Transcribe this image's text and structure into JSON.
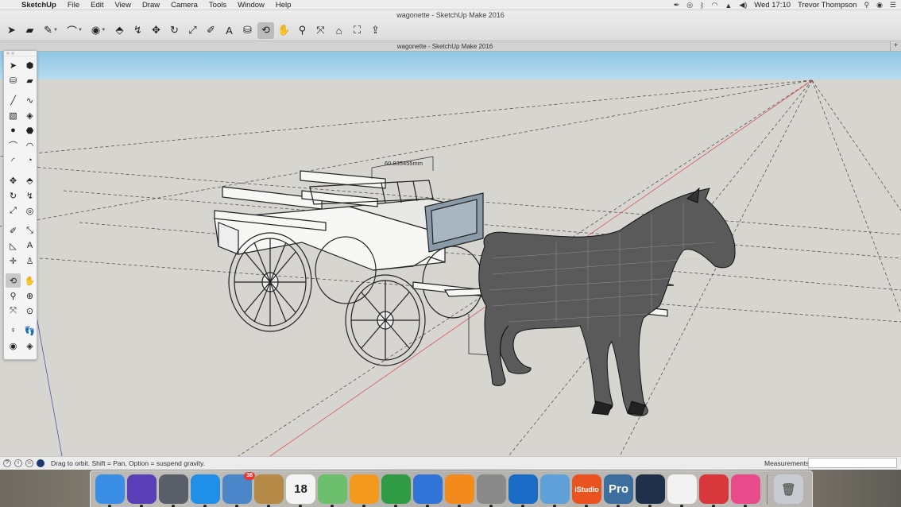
{
  "menubar": {
    "app": "SketchUp",
    "items": [
      "File",
      "Edit",
      "View",
      "Draw",
      "Camera",
      "Tools",
      "Window",
      "Help"
    ],
    "clock": "Wed 17:10",
    "user": "Trevor Thompson"
  },
  "window": {
    "title": "wagonette - SketchUp Make 2016",
    "tab_title": "wagonette - SketchUp Make 2016"
  },
  "toolbar": {
    "tools": [
      {
        "icon": "select-arrow-icon",
        "glyph": "➤"
      },
      {
        "icon": "eraser-icon",
        "glyph": "▰"
      },
      {
        "icon": "pencil-line-icon",
        "glyph": "✎",
        "dropdown": true
      },
      {
        "icon": "arc-icon",
        "glyph": "⌒",
        "dropdown": true
      },
      {
        "icon": "circle-shape-icon",
        "glyph": "◉",
        "dropdown": true
      },
      {
        "icon": "push-pull-icon",
        "glyph": "⬘"
      },
      {
        "icon": "follow-me-icon",
        "glyph": "↯"
      },
      {
        "icon": "move-icon",
        "glyph": "✥"
      },
      {
        "icon": "rotate-icon",
        "glyph": "↻"
      },
      {
        "icon": "scale-icon",
        "glyph": "⤢"
      },
      {
        "icon": "tape-measure-icon",
        "glyph": "✐"
      },
      {
        "icon": "text-icon",
        "glyph": "A"
      },
      {
        "icon": "paint-bucket-icon",
        "glyph": "⛁"
      },
      {
        "icon": "orbit-icon",
        "glyph": "⟲",
        "active": true
      },
      {
        "icon": "pan-icon",
        "glyph": "✋"
      },
      {
        "icon": "zoom-icon",
        "glyph": "⚲"
      },
      {
        "icon": "zoom-extents-icon",
        "glyph": "⤧"
      },
      {
        "icon": "warehouse-icon",
        "glyph": "⌂"
      },
      {
        "icon": "extension-warehouse-icon",
        "glyph": "⛶"
      },
      {
        "icon": "share-model-icon",
        "glyph": "⇪"
      }
    ]
  },
  "palette": {
    "tools": [
      {
        "icon": "select-icon",
        "glyph": "➤"
      },
      {
        "icon": "make-component-icon",
        "glyph": "⬢"
      },
      {
        "icon": "paint-bucket-icon",
        "glyph": "⛁"
      },
      {
        "icon": "eraser-icon",
        "glyph": "▰"
      },
      {
        "sep": true
      },
      {
        "icon": "line-icon",
        "glyph": "╱"
      },
      {
        "icon": "freehand-icon",
        "glyph": "∿"
      },
      {
        "icon": "rectangle-icon",
        "glyph": "▧"
      },
      {
        "icon": "rotated-rectangle-icon",
        "glyph": "◈"
      },
      {
        "icon": "circle-icon",
        "glyph": "●"
      },
      {
        "icon": "polygon-icon",
        "glyph": "⬣"
      },
      {
        "icon": "arc-icon",
        "glyph": "⌒"
      },
      {
        "icon": "two-point-arc-icon",
        "glyph": "◠"
      },
      {
        "icon": "three-point-arc-icon",
        "glyph": "◜"
      },
      {
        "icon": "pie-icon",
        "glyph": "◔"
      },
      {
        "sep": true
      },
      {
        "icon": "move-icon",
        "glyph": "✥"
      },
      {
        "icon": "push-pull-icon",
        "glyph": "⬘"
      },
      {
        "icon": "rotate-icon",
        "glyph": "↻"
      },
      {
        "icon": "follow-me-icon",
        "glyph": "↯"
      },
      {
        "icon": "scale-icon",
        "glyph": "⤢"
      },
      {
        "icon": "offset-icon",
        "glyph": "◎"
      },
      {
        "sep": true
      },
      {
        "icon": "tape-measure-icon",
        "glyph": "✐"
      },
      {
        "icon": "dimension-icon",
        "glyph": "⤡"
      },
      {
        "icon": "protractor-icon",
        "glyph": "◺"
      },
      {
        "icon": "text-icon",
        "glyph": "A"
      },
      {
        "icon": "axes-icon",
        "glyph": "✛"
      },
      {
        "icon": "3d-text-icon",
        "glyph": "♙"
      },
      {
        "sep": true
      },
      {
        "icon": "orbit-icon",
        "glyph": "⟲",
        "active": true
      },
      {
        "icon": "pan-icon",
        "glyph": "✋"
      },
      {
        "icon": "zoom-icon",
        "glyph": "⚲"
      },
      {
        "icon": "zoom-window-icon",
        "glyph": "⊕"
      },
      {
        "icon": "zoom-extents-icon",
        "glyph": "⤧"
      },
      {
        "icon": "previous-view-icon",
        "glyph": "⊙"
      },
      {
        "sep": true
      },
      {
        "icon": "position-camera-icon",
        "glyph": "♀"
      },
      {
        "icon": "walk-icon",
        "glyph": "👣"
      },
      {
        "icon": "look-around-icon",
        "glyph": "◉"
      },
      {
        "icon": "section-plane-icon",
        "glyph": "◈"
      }
    ]
  },
  "model": {
    "dimension_label": "60.835455mm"
  },
  "status": {
    "hint": "Drag to orbit. Shift = Pan, Option = suspend gravity.",
    "measurements_label": "Measurements",
    "measurements_value": ""
  },
  "dock": {
    "apps": [
      {
        "name": "finder",
        "label": "",
        "color": "#3a8ee6"
      },
      {
        "name": "siri",
        "label": "",
        "color": "#5b3fb8"
      },
      {
        "name": "launchpad",
        "label": "",
        "color": "#5a5f6a"
      },
      {
        "name": "safari",
        "label": "",
        "color": "#1f8fe8"
      },
      {
        "name": "mail",
        "label": "",
        "color": "#4a86c8",
        "badge": "38"
      },
      {
        "name": "notes",
        "label": "",
        "color": "#b48a46"
      },
      {
        "name": "calendar",
        "label": "18",
        "color": "#f4f4f4",
        "text": "#222"
      },
      {
        "name": "maps",
        "label": "",
        "color": "#6cbf6c"
      },
      {
        "name": "pages",
        "label": "",
        "color": "#f39a1e"
      },
      {
        "name": "numbers",
        "label": "",
        "color": "#2f9b44"
      },
      {
        "name": "keynote",
        "label": "",
        "color": "#2f74d6"
      },
      {
        "name": "ibooks",
        "label": "",
        "color": "#f28a1c"
      },
      {
        "name": "system-preferences",
        "label": "",
        "color": "#8a8a8a"
      },
      {
        "name": "teamviewer",
        "label": "",
        "color": "#1b6cc7"
      },
      {
        "name": "preview",
        "label": "",
        "color": "#5fa0d8"
      },
      {
        "name": "istudio",
        "label": "iStudio",
        "color": "#e8531f"
      },
      {
        "name": "google-earth-pro",
        "label": "Pro",
        "color": "#3d6e9e"
      },
      {
        "name": "sketchup-dark",
        "label": "",
        "color": "#20304a"
      },
      {
        "name": "photos",
        "label": "",
        "color": "#f2f2f2"
      },
      {
        "name": "sketchup",
        "label": "",
        "color": "#d8383b"
      },
      {
        "name": "itunes",
        "label": "",
        "color": "#e84b8a"
      }
    ],
    "trash": {
      "name": "trash",
      "color": "#c8ccd2"
    }
  }
}
